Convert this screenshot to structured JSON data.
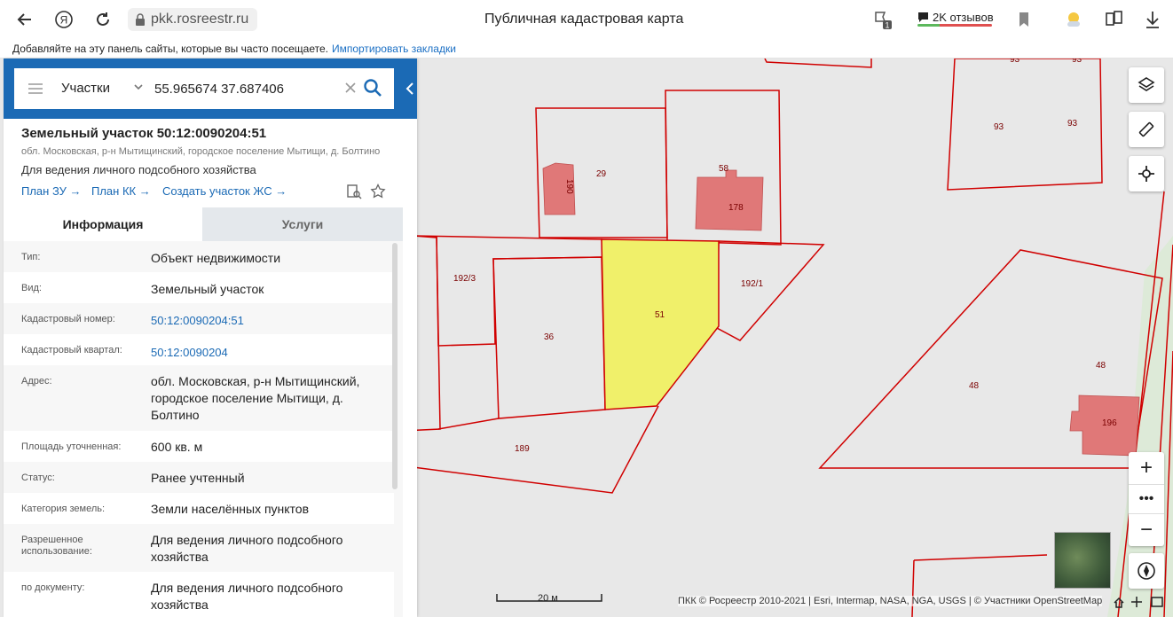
{
  "browser": {
    "url": "pkk.rosreestr.ru",
    "title": "Публичная кадастровая карта",
    "reviews_label": "2K отзывов",
    "notifications_count": "1",
    "bookmarks_hint": "Добавляйте на эту панель сайты, которые вы часто посещаете.",
    "bookmarks_import": "Импортировать закладки"
  },
  "search": {
    "type_label": "Участки",
    "query": "55.965674 37.687406"
  },
  "parcel": {
    "title": "Земельный участок 50:12:0090204:51",
    "address_short": "обл. Московская, р-н Мытищинский, городское поселение Мытищи, д. Болтино",
    "use": "Для ведения личного подсобного хозяйства",
    "links": {
      "plan_zu": "План ЗУ →",
      "plan_kk": "План КК →",
      "create": "Создать участок ЖС →"
    }
  },
  "tabs": {
    "info": "Информация",
    "services": "Услуги"
  },
  "info_rows": [
    {
      "key": "Тип:",
      "value": "Объект недвижимости"
    },
    {
      "key": "Вид:",
      "value": "Земельный участок"
    },
    {
      "key": "Кадастровый номер:",
      "value": "50:12:0090204:51"
    },
    {
      "key": "Кадастровый квартал:",
      "value": "50:12:0090204"
    },
    {
      "key": "Адрес:",
      "value": "обл. Московская, р-н Мытищинский, городское поселение Мытищи, д. Болтино"
    },
    {
      "key": "Площадь уточненная:",
      "value": "600 кв. м"
    },
    {
      "key": "Статус:",
      "value": "Ранее учтенный"
    },
    {
      "key": "Категория земель:",
      "value": "Земли населённых пунктов"
    },
    {
      "key": "Разрешенное использование:",
      "value": "Для ведения личного подсобного хозяйства"
    },
    {
      "key": "по документу:",
      "value": "Для ведения личного подсобного хозяйства"
    }
  ],
  "map": {
    "labels": {
      "p93a": "93",
      "p93b": "93",
      "p93c": "93",
      "p93d": "93",
      "p29": "29",
      "p190": "190",
      "p58": "58",
      "p178": "178",
      "p192_3": "192/3",
      "p192_1": "192/1",
      "p51": "51",
      "p36": "36",
      "p48a": "48",
      "p48b": "48",
      "p196": "196",
      "p189": "189"
    },
    "scale_label": "20 м",
    "attribution": "ПКК © Росреестр 2010-2021 | Esri, Intermap, NASA, NGA, USGS | © Участники OpenStreetMap",
    "colors": {
      "boundary": "#d00000",
      "selected_fill": "#f0f06a",
      "building_fill": "#e07878",
      "background": "#e8e8e8",
      "panel_header": "#1b6ab5"
    }
  }
}
